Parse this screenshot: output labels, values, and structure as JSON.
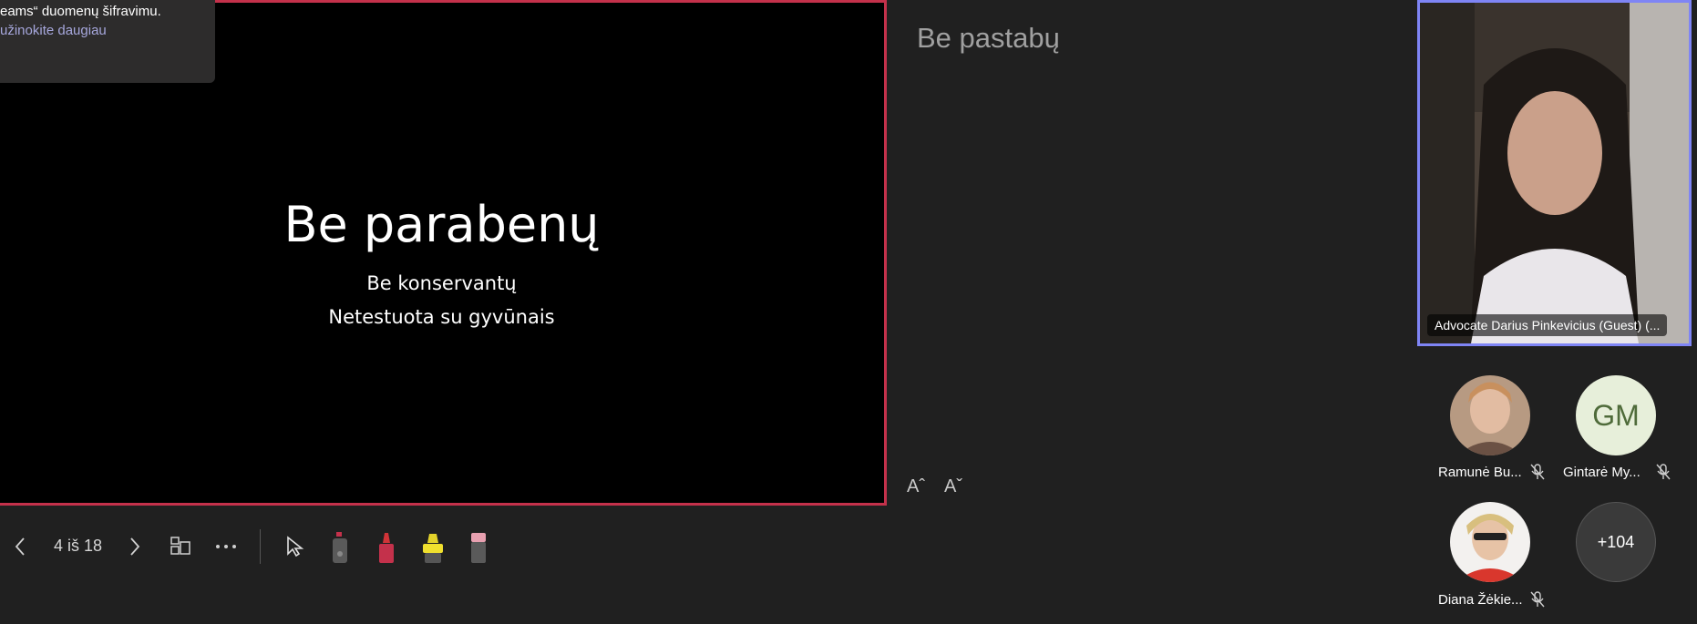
{
  "toast": {
    "line1": "eams“ duomenų šifravimu.",
    "link": "užinokite daugiau"
  },
  "slide": {
    "title": "Be parabenų",
    "line1": "Be konservantų",
    "line2": "Netestuota su gyvūnais"
  },
  "notes": {
    "text": "Be pastabų",
    "increase_font": "Aˆ",
    "decrease_font": "Aˇ"
  },
  "toolbar": {
    "slide_counter": "4 iš 18"
  },
  "video": {
    "self_label": "Advocate Darius Pinkevicius (Guest) (..."
  },
  "participants": [
    {
      "name": "Ramunė Bu...",
      "initials": ""
    },
    {
      "name": "Gintarė My...",
      "initials": "GM"
    },
    {
      "name": "Diana Žėkie...",
      "initials": ""
    }
  ],
  "more_count": "+104",
  "colors": {
    "slide_border": "#c4314b",
    "self_border": "#7f85f5",
    "link": "#a6a7dc",
    "gm_avatar_bg": "#e7efda",
    "gm_avatar_text": "#4f6b3a"
  }
}
